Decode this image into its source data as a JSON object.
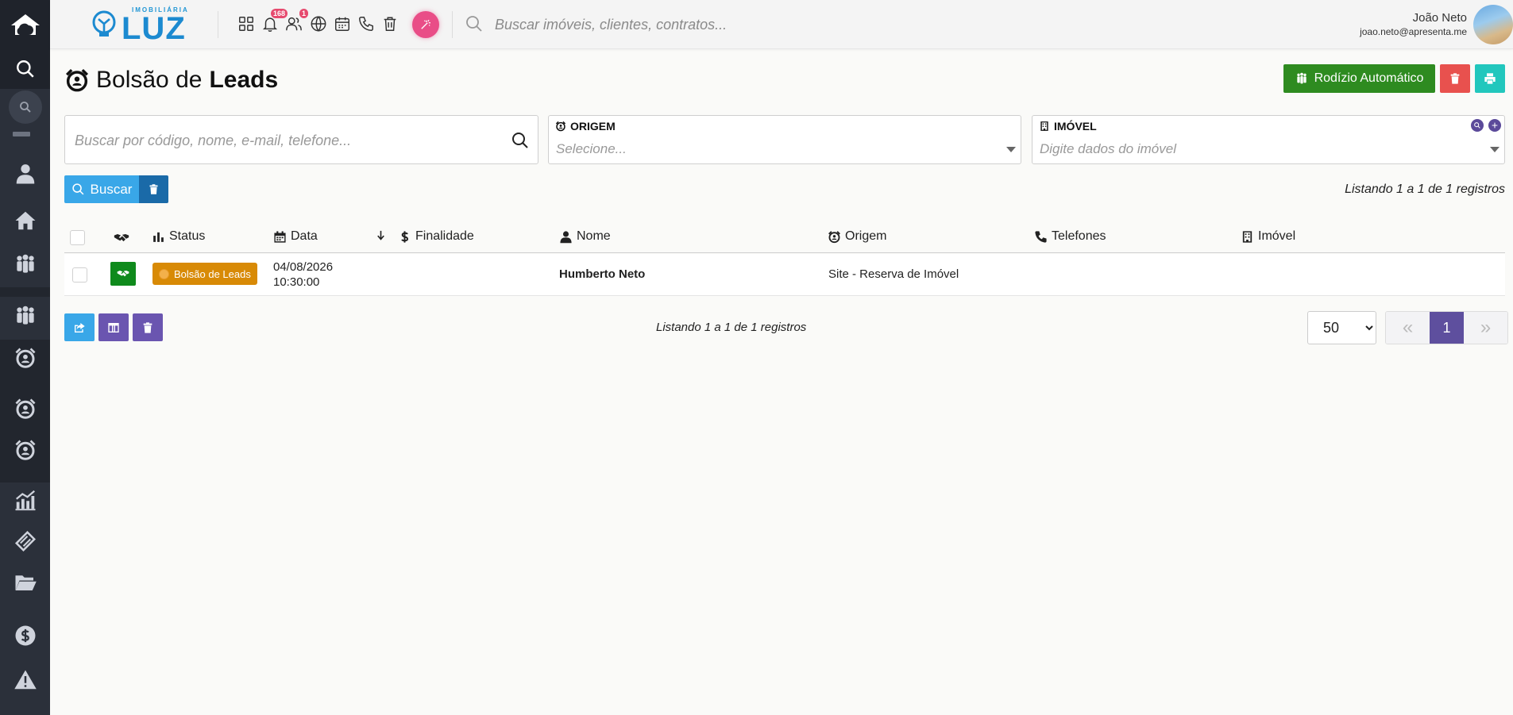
{
  "app": {
    "logo_small": "IMOBILIÁRIA",
    "logo_main": "LUZ"
  },
  "topbar": {
    "notifications_badge": "168",
    "users_badge": "1",
    "search_placeholder": "Buscar imóveis, clientes, contratos...",
    "user_name": "João Neto",
    "user_email": "joao.neto@apresenta.me"
  },
  "page": {
    "title_part1": "Bolsão de",
    "title_part2": "Leads",
    "rodizio_label": "Rodízio Automático"
  },
  "filters": {
    "search_placeholder": "Buscar por código, nome, e-mail, telefone...",
    "origem_label": "ORIGEM",
    "origem_placeholder": "Selecione...",
    "imovel_label": "IMÓVEL",
    "imovel_placeholder": "Digite dados do imóvel",
    "buscar_label": "Buscar"
  },
  "listing": {
    "text": "Listando 1 a 1 de 1 registros"
  },
  "table": {
    "columns": {
      "status": "Status",
      "data": "Data",
      "finalidade": "Finalidade",
      "nome": "Nome",
      "origem": "Origem",
      "telefones": "Telefones",
      "imovel": "Imóvel"
    },
    "rows": [
      {
        "status": "Bolsão de Leads",
        "date": "04/08/2026",
        "time": "10:30:00",
        "finalidade": "",
        "nome": "Humberto Neto",
        "origem": "Site - Reserva de Imóvel",
        "telefones": "",
        "imovel": ""
      }
    ]
  },
  "pagination": {
    "page_size": "50",
    "page_size_options": [
      "50"
    ],
    "first": "«",
    "current": "1",
    "last": "»"
  },
  "colors": {
    "sidebar": "#2b303a",
    "green": "#2e8b20",
    "red": "#e8514e",
    "teal": "#22c7bd",
    "blue": "#39a7e8",
    "purple": "#5e4f9e",
    "status_orange": "#d88a06"
  },
  "icons": {
    "sidebar": [
      "home-cloud-icon",
      "search-icon",
      "mini-search-icon",
      "user-icon",
      "house-icon",
      "group-icon",
      "group-icon",
      "alarm-icon",
      "alarm-icon",
      "alarm-icon",
      "chart-icon",
      "ticket-icon",
      "folder-icon",
      "dollar-icon",
      "warning-icon"
    ]
  }
}
